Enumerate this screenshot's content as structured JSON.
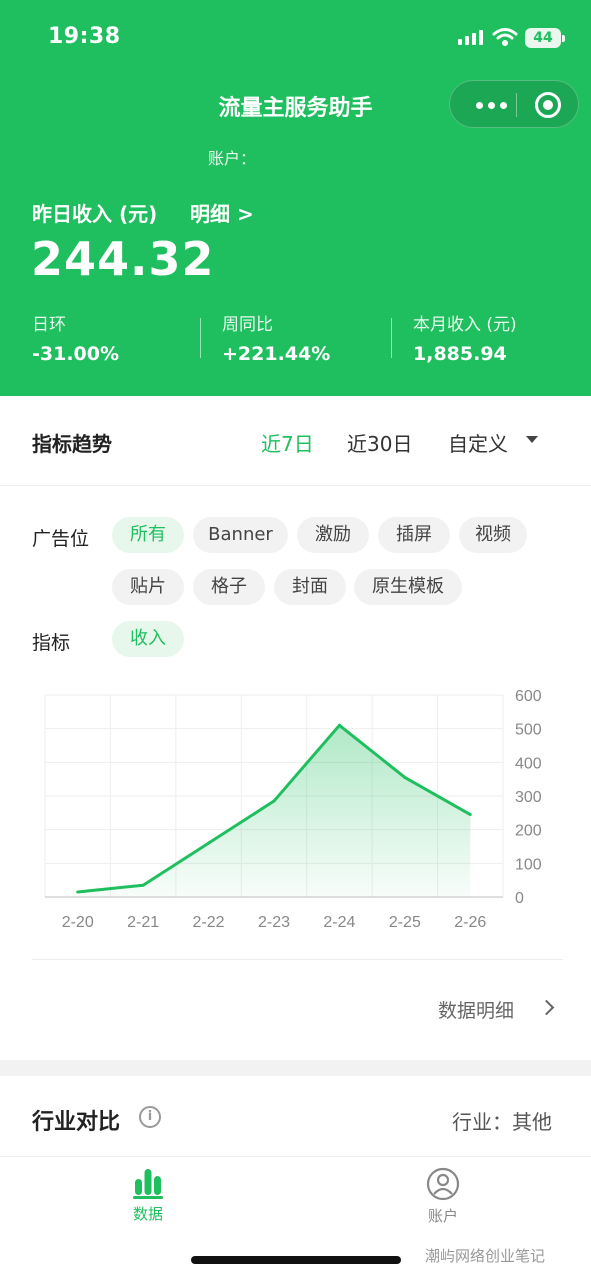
{
  "status": {
    "time": "19:38",
    "battery": "44"
  },
  "nav": {
    "title": "流量主服务助手"
  },
  "account": {
    "label": "账户："
  },
  "income": {
    "label": "昨日收入 (元)",
    "detail_link": "明细 >",
    "value": "244.32",
    "stats": [
      {
        "label": "日环",
        "value": "-31.00%"
      },
      {
        "label": "周同比",
        "value": "+221.44%"
      },
      {
        "label": "本月收入 (元)",
        "value": "1,885.94"
      }
    ]
  },
  "trend": {
    "title": "指标趋势",
    "ranges": [
      "近7日",
      "近30日",
      "自定义"
    ],
    "active_range": "近7日"
  },
  "filters": {
    "ad_slot_label": "广告位",
    "ad_slots": [
      "所有",
      "Banner",
      "激励",
      "插屏",
      "视频",
      "贴片",
      "格子",
      "封面",
      "原生模板"
    ],
    "metric_label": "指标",
    "metrics": [
      "收入"
    ]
  },
  "chart_data": {
    "type": "area",
    "categories": [
      "2-20",
      "2-21",
      "2-22",
      "2-23",
      "2-24",
      "2-25",
      "2-26"
    ],
    "series": [
      {
        "values": [
          15,
          35,
          160,
          285,
          510,
          355,
          245
        ]
      }
    ],
    "y_ticks": [
      "600",
      "500",
      "400",
      "300",
      "200",
      "100",
      "0"
    ],
    "ylim": [
      0,
      600
    ],
    "grid": true,
    "color": "#1fbf5f"
  },
  "data_detail": {
    "label": "数据明细"
  },
  "industry": {
    "title": "行业对比",
    "info_icon": "i",
    "value": "行业：其他"
  },
  "tabbar": {
    "items": [
      {
        "label": "数据",
        "icon": "bar-chart-icon",
        "active": true
      },
      {
        "label": "账户",
        "icon": "user-icon",
        "active": false
      }
    ]
  },
  "watermark": "潮屿网络创业笔记"
}
